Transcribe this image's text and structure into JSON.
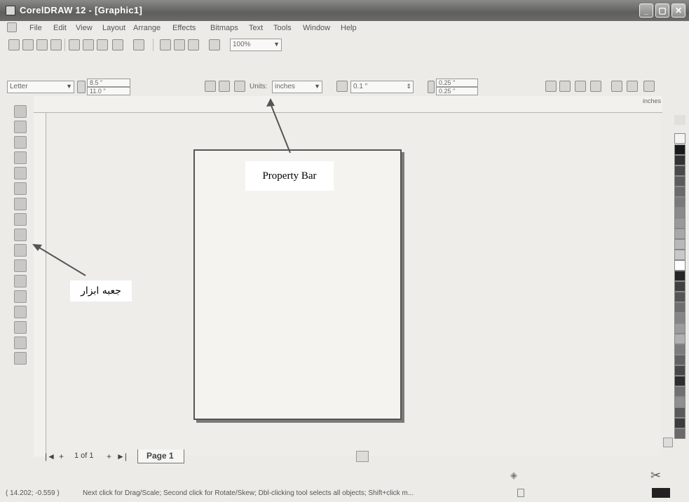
{
  "window": {
    "title": "CorelDRAW 12 - [Graphic1]",
    "controls": [
      "minimize-icon",
      "maximize-icon",
      "close-icon"
    ]
  },
  "menubar": {
    "items": [
      "File",
      "Edit",
      "View",
      "Layout",
      "Arrange",
      "Effects",
      "Bitmaps",
      "Text",
      "Tools",
      "Window",
      "Help"
    ]
  },
  "standard_toolbar": {
    "zoom_value": "100%"
  },
  "property_bar": {
    "paper_type": "Letter",
    "width": "8.5 \"",
    "height": "11.0 \"",
    "units_label": "Units:",
    "units_value": "inches",
    "nudge": "0.1 \"",
    "dup_x": "0.25 \"",
    "dup_y": "0.25 \""
  },
  "ruler": {
    "unit_label": "inches"
  },
  "page_nav": {
    "position": "1 of 1",
    "page_tab": "Page 1"
  },
  "status": {
    "coords": "( 14.202; -0.559 )",
    "message": "Next click for Drag/Scale; Second click for Rotate/Skew; Dbl-clicking tool selects all objects; Shift+click m..."
  },
  "annotations": {
    "property_bar_label": "Property Bar",
    "toolbox_label": "جعبه ابزار"
  },
  "palette_colors": [
    "#1a1a1a",
    "#333333",
    "#4a4a4a",
    "#5c5c5c",
    "#6b6b6b",
    "#7a7a7a",
    "#8a8a8a",
    "#999999",
    "#a8a8a8",
    "#b8b8b8",
    "#c8c8c8",
    "#ffffff",
    "#252525",
    "#404040",
    "#555555",
    "#6e6e6e",
    "#858585",
    "#9c9c9c",
    "#b0b0b0",
    "#7c7c7c",
    "#626262",
    "#484848",
    "#2e2e2e",
    "#707070",
    "#8f8f8f",
    "#5a5a5a",
    "#3c3c3c",
    "#6a6a6a"
  ]
}
